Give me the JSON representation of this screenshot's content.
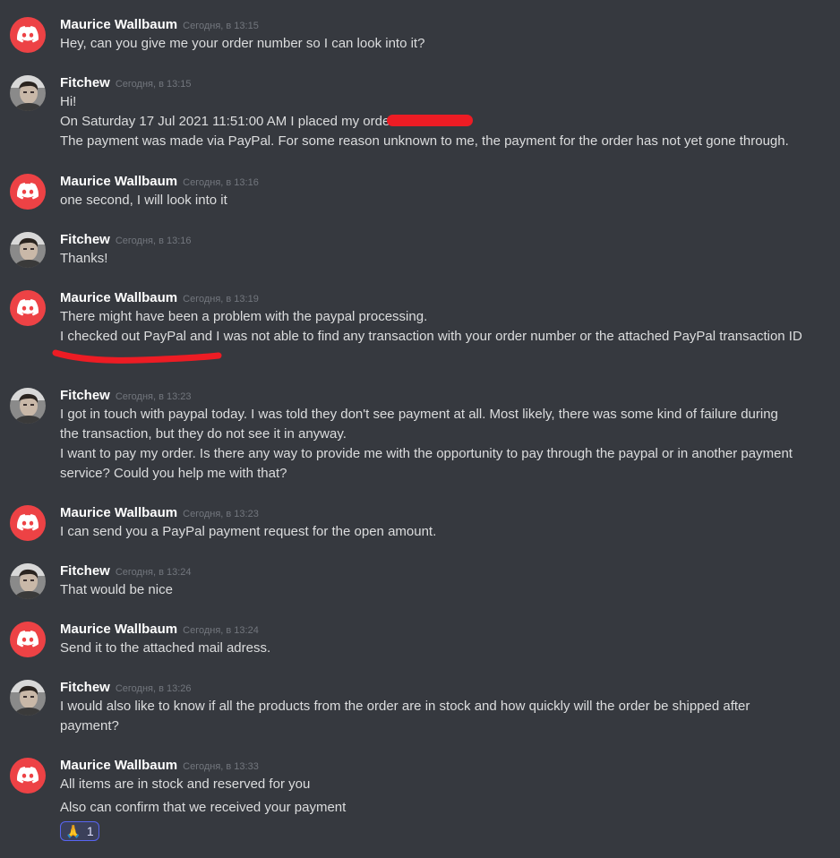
{
  "messages": [
    {
      "author": "Maurice Wallbaum",
      "time": "Сегодня, в 13:15",
      "avatar": "discord-logo-icon",
      "lines": [
        "Hey, can you give me your order number so I can look into it?"
      ]
    },
    {
      "author": "Fitchew",
      "time": "Сегодня, в 13:15",
      "avatar": "user-photo",
      "lines": [
        "Hi!",
        "On Saturday 17 Jul 2021 11:51:00 AM I placed my order",
        "The payment was made via PayPal. For some reason unknown to me, the payment for the order has not yet gone through."
      ]
    },
    {
      "author": "Maurice Wallbaum",
      "time": "Сегодня, в 13:16",
      "avatar": "discord-logo-icon",
      "lines": [
        "one second, I will look into it"
      ]
    },
    {
      "author": "Fitchew",
      "time": "Сегодня, в 13:16",
      "avatar": "user-photo",
      "lines": [
        "Thanks!"
      ]
    },
    {
      "author": "Maurice Wallbaum",
      "time": "Сегодня, в 13:19",
      "avatar": "discord-logo-icon",
      "lines": [
        "There might have been a problem with the paypal processing.",
        "I checked out PayPal and I was not able to find any transaction with your order number or the attached PayPal transaction ID"
      ]
    },
    {
      "author": "Fitchew",
      "time": "Сегодня, в 13:23",
      "avatar": "user-photo",
      "lines": [
        "I got in touch with paypal today. I was told they don't see payment at all. Most likely, there was some kind of failure during",
        "the transaction, but they do not see it in anyway.",
        "I want to pay my order. Is there any way to provide me with the opportunity to pay through the paypal or in another payment",
        "service? Could you help me with that?"
      ]
    },
    {
      "author": "Maurice Wallbaum",
      "time": "Сегодня, в 13:23",
      "avatar": "discord-logo-icon",
      "lines": [
        "I can send you a PayPal payment request for the open amount."
      ]
    },
    {
      "author": "Fitchew",
      "time": "Сегодня, в 13:24",
      "avatar": "user-photo",
      "lines": [
        "That would be nice"
      ]
    },
    {
      "author": "Maurice Wallbaum",
      "time": "Сегодня, в 13:24",
      "avatar": "discord-logo-icon",
      "lines": [
        "Send it to the attached mail adress."
      ]
    },
    {
      "author": "Fitchew",
      "time": "Сегодня, в 13:26",
      "avatar": "user-photo",
      "lines": [
        "I would also like to know if all the products from the order are in stock and how quickly will the order be shipped after",
        "payment?"
      ]
    },
    {
      "author": "Maurice Wallbaum",
      "time": "Сегодня, в 13:33",
      "avatar": "discord-logo-icon",
      "lines": [
        "All items are in stock and reserved for you",
        "Also can confirm that we received your payment"
      ]
    }
  ],
  "reaction": {
    "emoji": "🙏",
    "icon": "folded-hands-icon",
    "count": "1"
  },
  "colors": {
    "background": "#36393f",
    "discord_red": "#ed4245",
    "redaction": "#ed1c24",
    "author": "#ffffff",
    "timestamp": "#72767d",
    "text": "#dcddde"
  }
}
